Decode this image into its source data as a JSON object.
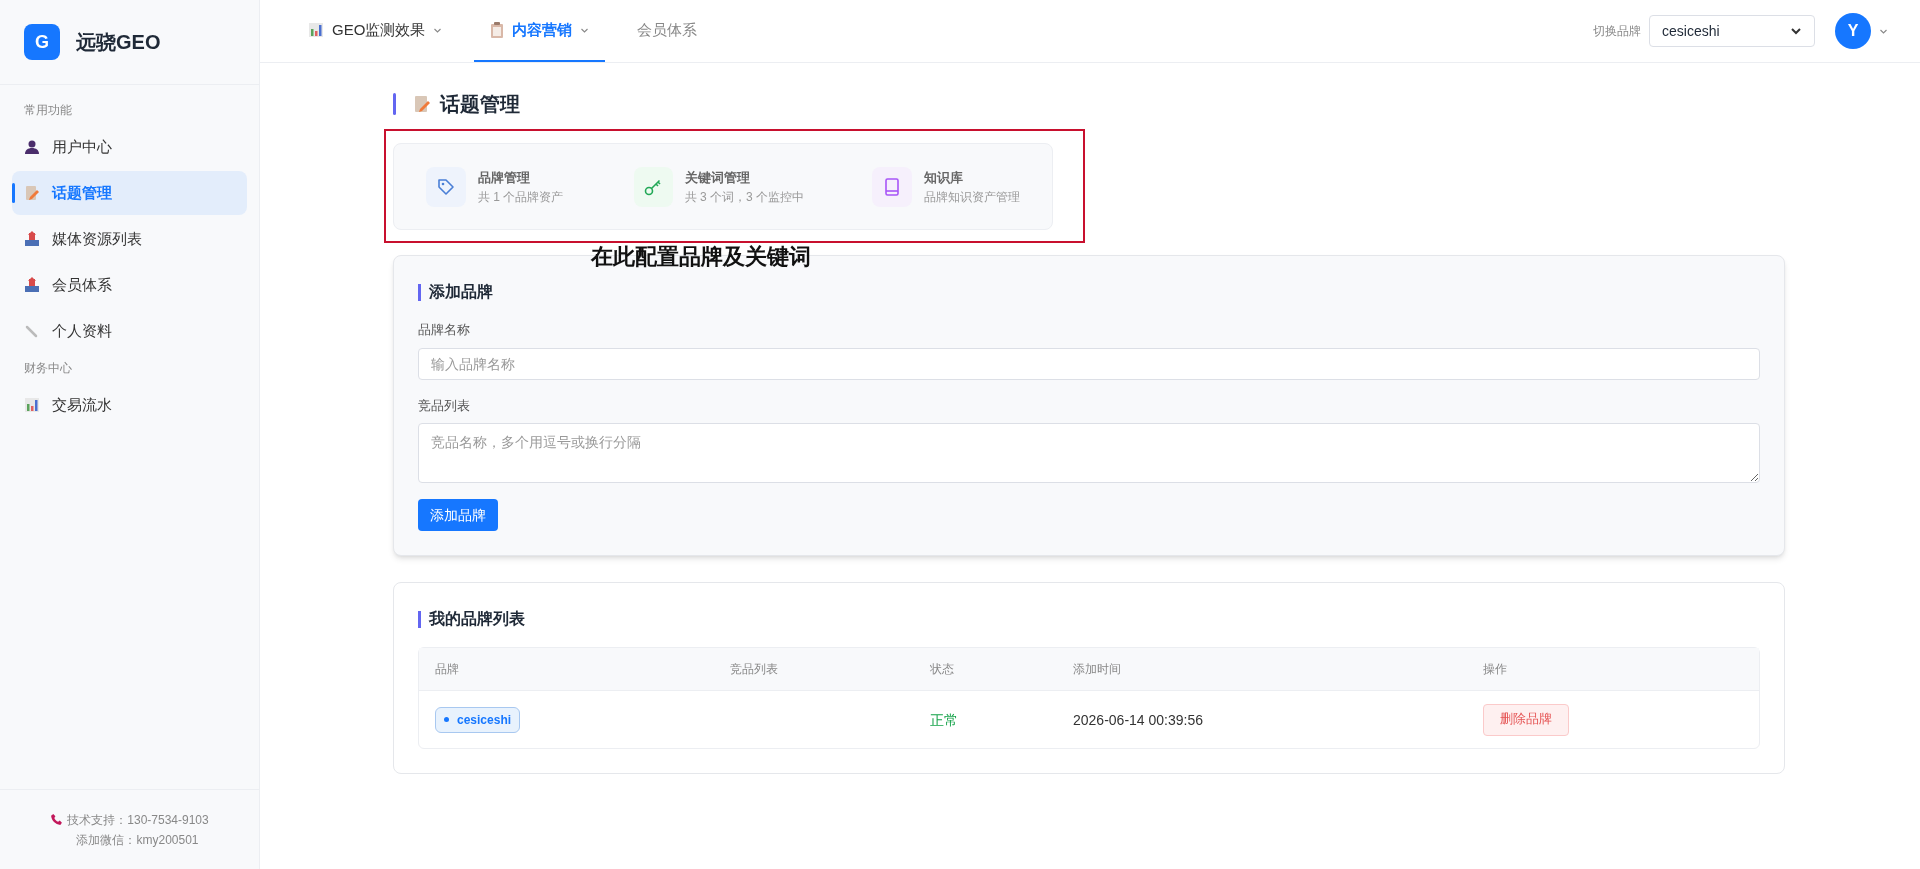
{
  "logo": {
    "letter": "G",
    "title": "远骁GEO"
  },
  "sidebar": {
    "sections": [
      {
        "title": "常用功能",
        "items": [
          {
            "label": "用户中心",
            "kind": "user",
            "selected": false
          },
          {
            "label": "话题管理",
            "kind": "memo",
            "selected": true
          },
          {
            "label": "媒体资源列表",
            "kind": "inbox",
            "selected": false
          },
          {
            "label": "会员体系",
            "kind": "inbox",
            "selected": false
          },
          {
            "label": "个人资料",
            "kind": "bone",
            "selected": false
          }
        ]
      },
      {
        "title": "财务中心",
        "items": [
          {
            "label": "交易流水",
            "kind": "chart",
            "selected": false
          }
        ]
      }
    ],
    "footer": {
      "support": "技术支持：130-7534-9103",
      "wechat": "添加微信：kmy200501"
    }
  },
  "top_nav": {
    "tabs": [
      {
        "label": "GEO监测效果",
        "kind": "chart",
        "dropdown": true,
        "selected": false
      },
      {
        "label": "内容营销",
        "kind": "clipboard",
        "dropdown": true,
        "selected": true
      },
      {
        "label": "会员体系",
        "kind": "plain",
        "dropdown": false,
        "selected": false
      }
    ],
    "brand_switch": {
      "label": "切换品牌",
      "value": "cesiceshi"
    },
    "avatar": "Y"
  },
  "page_title": "话题管理",
  "summary_cards": [
    {
      "kind": "tag",
      "title": "品牌管理",
      "subtitle": "共 1 个品牌资产"
    },
    {
      "kind": "key",
      "title": "关键词管理",
      "subtitle": "共 3 个词，3 个监控中"
    },
    {
      "kind": "book",
      "title": "知识库",
      "subtitle": "品牌知识资产管理"
    }
  ],
  "annotation": "在此配置品牌及关键词",
  "add_brand": {
    "title": "添加品牌",
    "name_label": "品牌名称",
    "name_placeholder": "输入品牌名称",
    "competitors_label": "竞品列表",
    "competitors_placeholder": "竞品名称，多个用逗号或换行分隔",
    "submit": "添加品牌"
  },
  "brand_list": {
    "title": "我的品牌列表",
    "columns": [
      "品牌",
      "竞品列表",
      "状态",
      "添加时间",
      "操作"
    ],
    "rows": [
      {
        "brand": "cesiceshi",
        "status": "正常",
        "added": "2026-06-14 00:39:56",
        "action": "删除品牌"
      }
    ]
  }
}
